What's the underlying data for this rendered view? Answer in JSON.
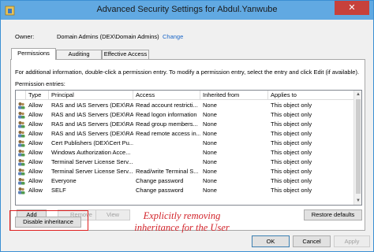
{
  "window": {
    "title": "Advanced Security Settings for Abdul.Yanwube",
    "close_glyph": "✕"
  },
  "owner": {
    "label": "Owner:",
    "value": "Domain Admins (DEX\\Domain Admins)",
    "change_label": "Change"
  },
  "tabs": [
    {
      "label": "Permissions",
      "active": true
    },
    {
      "label": "Auditing",
      "active": false
    },
    {
      "label": "Effective Access",
      "active": false
    }
  ],
  "permissions": {
    "info_text": "For additional information, double-click a permission entry. To modify a permission entry, select the entry and click Edit (if available).",
    "entries_label": "Permission entries:",
    "columns": [
      "Type",
      "Principal",
      "Access",
      "Inherited from",
      "Applies to"
    ],
    "rows": [
      [
        "Allow",
        "RAS and IAS Servers (DEX\\RA...",
        "Read account restricti...",
        "None",
        "This object only"
      ],
      [
        "Allow",
        "RAS and IAS Servers (DEX\\RA...",
        "Read logon information",
        "None",
        "This object only"
      ],
      [
        "Allow",
        "RAS and IAS Servers (DEX\\RA...",
        "Read group members...",
        "None",
        "This object only"
      ],
      [
        "Allow",
        "RAS and IAS Servers (DEX\\RA...",
        "Read remote access in...",
        "None",
        "This object only"
      ],
      [
        "Allow",
        "Cert Publishers (DEX\\Cert Pu...",
        "",
        "None",
        "This object only"
      ],
      [
        "Allow",
        "Windows Authorization Acce...",
        "",
        "None",
        "This object only"
      ],
      [
        "Allow",
        "Terminal Server License Serv...",
        "",
        "None",
        "This object only"
      ],
      [
        "Allow",
        "Terminal Server License Serv...",
        "Read/write Terminal S...",
        "None",
        "This object only"
      ],
      [
        "Allow",
        "Everyone",
        "Change password",
        "None",
        "This object only"
      ],
      [
        "Allow",
        "SELF",
        "Change password",
        "None",
        "This object only"
      ]
    ]
  },
  "buttons": {
    "add": "Add",
    "remove": "Remove",
    "view": "View",
    "restore_defaults": "Restore defaults",
    "disable_inheritance": "Disable inheritance",
    "ok": "OK",
    "cancel": "Cancel",
    "apply": "Apply"
  },
  "annotation": {
    "line1": "Explicitly removing",
    "line2": "inheritance for the User",
    "color": "#d2232a"
  },
  "colors": {
    "titlebar": "#61a9e2",
    "close": "#c7413b",
    "link": "#1a66c7"
  }
}
